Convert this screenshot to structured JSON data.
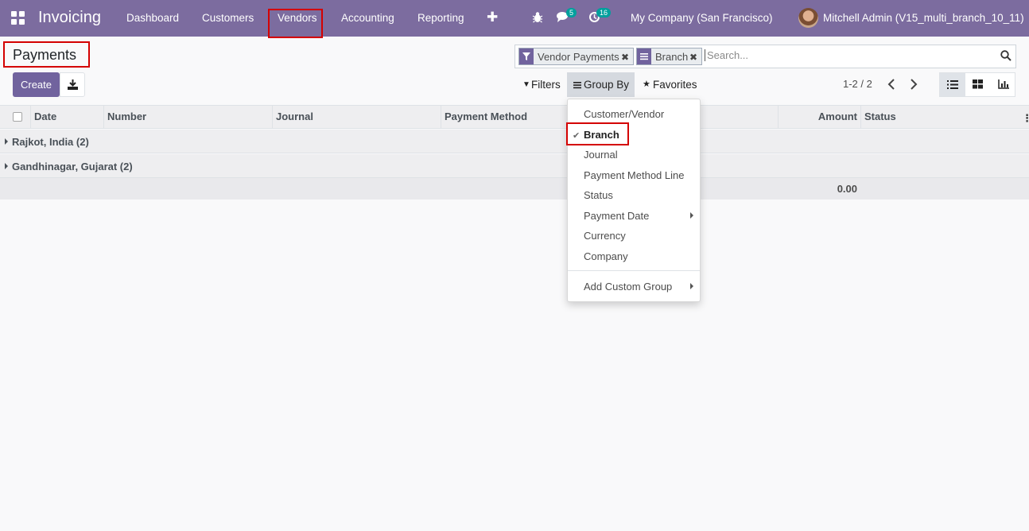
{
  "navbar": {
    "app_name": "Invoicing",
    "menu": [
      "Dashboard",
      "Customers",
      "Vendors",
      "Accounting",
      "Reporting"
    ],
    "plus_icon": "plus-icon",
    "messages_badge": "5",
    "activities_badge": "16",
    "company": "My Company (San Francisco)",
    "user": "Mitchell Admin (V15_multi_branch_10_11)"
  },
  "page": {
    "title": "Payments",
    "create_label": "Create"
  },
  "search": {
    "facets": [
      {
        "label": "Vendor Payments",
        "icon": "filter-icon"
      },
      {
        "label": "Branch",
        "icon": "group-by-icon"
      }
    ],
    "placeholder": "Search..."
  },
  "controls": {
    "filters_label": "Filters",
    "groupby_label": "Group By",
    "favorites_label": "Favorites",
    "pager": "1-2 / 2"
  },
  "list": {
    "columns": [
      "Date",
      "Number",
      "Journal",
      "Payment Method",
      "Amount",
      "Status"
    ],
    "groups": [
      {
        "label": "Rajkot, India (2)"
      },
      {
        "label": "Gandhinagar, Gujarat (2)"
      }
    ],
    "total_amount": "0.00"
  },
  "groupby_menu": {
    "items": [
      {
        "label": "Customer/Vendor",
        "selected": false,
        "submenu": false
      },
      {
        "label": "Branch",
        "selected": true,
        "submenu": false
      },
      {
        "label": "Journal",
        "selected": false,
        "submenu": false
      },
      {
        "label": "Payment Method Line",
        "selected": false,
        "submenu": false
      },
      {
        "label": "Status",
        "selected": false,
        "submenu": false
      },
      {
        "label": "Payment Date",
        "selected": false,
        "submenu": true
      },
      {
        "label": "Currency",
        "selected": false,
        "submenu": false
      },
      {
        "label": "Company",
        "selected": false,
        "submenu": false
      }
    ],
    "custom_group_label": "Add Custom Group"
  },
  "colors": {
    "brand": "#7c6c9f",
    "primary_button": "#71639e",
    "highlight": "#d40000",
    "badge": "#00a09d"
  }
}
